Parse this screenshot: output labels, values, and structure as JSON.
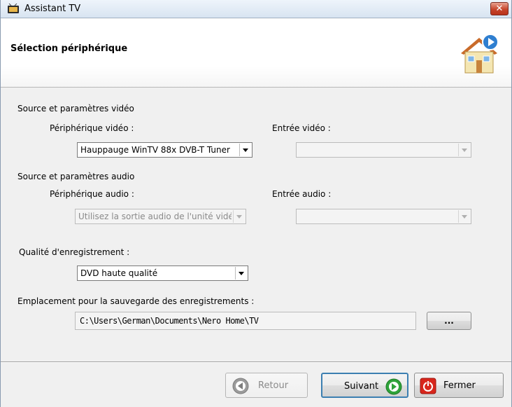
{
  "window": {
    "title": "Assistant TV",
    "close_symbol": "✕",
    "header_title": "Sélection périphérique",
    "header_icon": "house-play-icon"
  },
  "video": {
    "section_label": "Source et paramètres vidéo",
    "device_label": "Périphérique vidéo :",
    "device_value": "Hauppauge WinTV 88x DVB-T Tuner",
    "input_label": "Entrée vidéo :",
    "input_value": ""
  },
  "audio": {
    "section_label": "Source et paramètres audio",
    "device_label": "Périphérique audio :",
    "device_value": "Utilisez la sortie audio de l'unité vidéo",
    "input_label": "Entrée audio :",
    "input_value": ""
  },
  "quality": {
    "label": "Qualité d'enregistrement :",
    "value": "DVD haute qualité"
  },
  "location": {
    "label": "Emplacement pour la sauvegarde des enregistrements :",
    "path": "C:\\Users\\German\\Documents\\Nero Home\\TV",
    "browse_label": "..."
  },
  "footer": {
    "back_label": "Retour",
    "next_label": "Suivant",
    "close_label": "Fermer"
  },
  "colors": {
    "accent_blue": "#2f7fd0",
    "next_green": "#2fa33a",
    "close_red": "#d8261c"
  }
}
